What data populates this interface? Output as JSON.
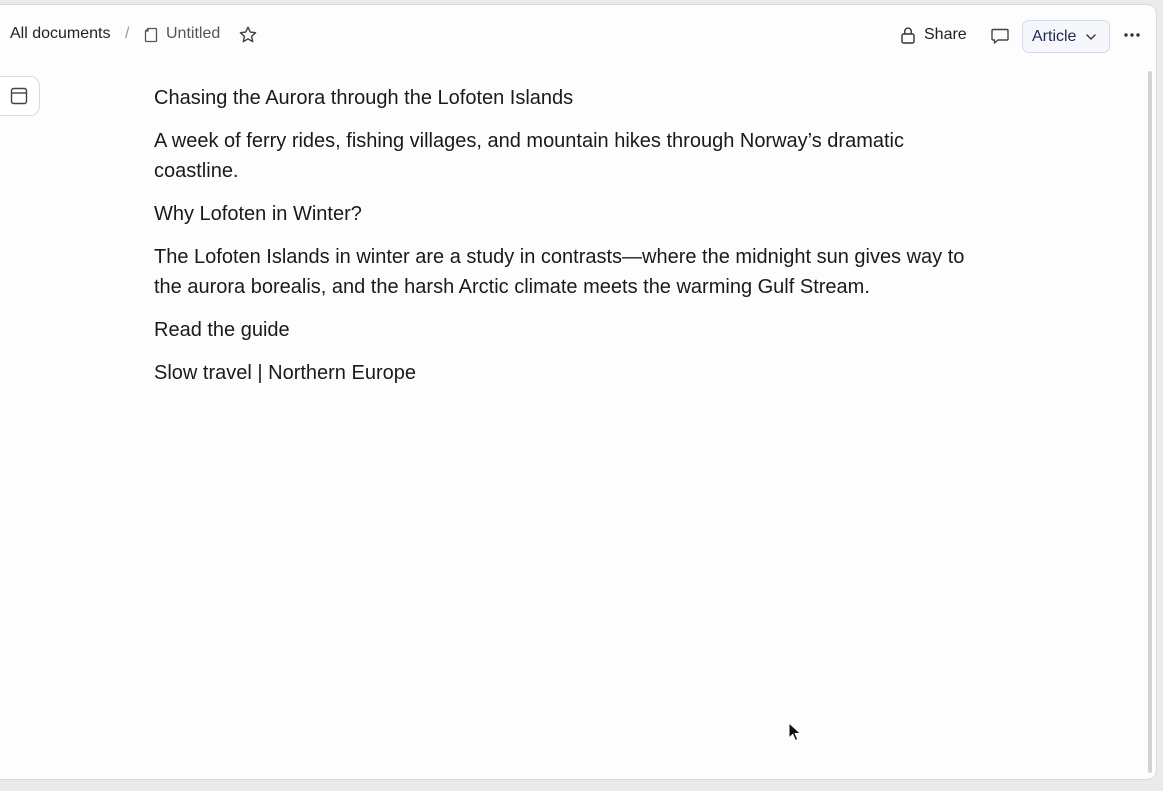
{
  "breadcrumb": {
    "root": "All documents",
    "separator": "/",
    "current": "Untitled"
  },
  "toolbar": {
    "share_label": "Share",
    "mode_label": "Article"
  },
  "document": {
    "title": "Chasing the Aurora through the Lofoten Islands",
    "subtitle": "A week of ferry rides, fishing villages, and mountain hikes through Norway’s dramatic coastline.",
    "heading": "Why Lofoten in Winter?",
    "body": "The Lofoten Islands in winter are a study in contrasts—where the midnight sun gives way to the aurora borealis, and the harsh Arctic climate meets the warming Gulf Stream.",
    "cta": "Read the guide",
    "tags": "Slow travel | Northern Europe"
  },
  "icons": {
    "doc": "document-icon",
    "star": "star-icon",
    "lock": "lock-icon",
    "comment": "comment-icon",
    "chevron": "chevron-down-icon",
    "more": "more-icon",
    "sidebar": "sidebar-panel-icon"
  },
  "colors": {
    "accent_bg": "#f6f7fc",
    "accent_border": "#d6d9e8",
    "accent_text": "#1e2a4a"
  }
}
